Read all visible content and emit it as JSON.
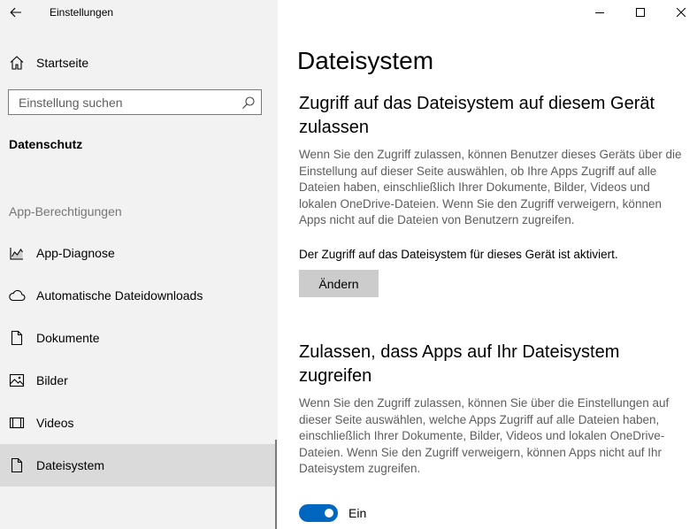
{
  "window": {
    "title": "Einstellungen",
    "controls": [
      "minimize",
      "maximize",
      "close"
    ]
  },
  "sidebar": {
    "home_label": "Startseite",
    "search_placeholder": "Einstellung suchen",
    "section_title": "Datenschutz",
    "group_title": "App-Berechtigungen",
    "items": [
      {
        "label": "App-Diagnose",
        "icon": "app-diagnose-icon"
      },
      {
        "label": "Automatische Dateidownloads",
        "icon": "cloud-icon"
      },
      {
        "label": "Dokumente",
        "icon": "document-icon"
      },
      {
        "label": "Bilder",
        "icon": "image-icon"
      },
      {
        "label": "Videos",
        "icon": "video-icon"
      },
      {
        "label": "Dateisystem",
        "icon": "document-icon",
        "selected": true
      }
    ]
  },
  "main": {
    "title": "Dateisystem",
    "device_section": {
      "heading": "Zugriff auf das Dateisystem auf diesem Gerät zulassen",
      "description": "Wenn Sie den Zugriff zulassen, können Benutzer dieses Geräts über die Einstellung auf dieser Seite auswählen, ob Ihre Apps Zugriff auf alle Dateien haben, einschließlich Ihrer Dokumente, Bilder, Videos und lokalen OneDrive-Dateien. Wenn Sie den Zugriff verweigern, können Apps nicht auf die Dateien von Benutzern zugreifen.",
      "status": "Der Zugriff auf das Dateisystem für dieses Gerät ist aktiviert.",
      "button_label": "Ändern"
    },
    "apps_section": {
      "heading": "Zulassen, dass Apps auf Ihr Dateisystem zugreifen",
      "description": "Wenn Sie den Zugriff zulassen, können Sie über die Einstellungen auf dieser Seite auswählen, welche Apps Zugriff auf alle Dateien haben, einschließlich Ihrer Dokumente, Bilder, Videos und lokalen OneDrive-Dateien. Wenn Sie den Zugriff verweigern, können Apps nicht auf Ihr Dateisystem zugreifen.",
      "toggle_state": "on",
      "toggle_label": "Ein"
    }
  },
  "colors": {
    "sidebar_bg": "#f2f2f2",
    "selected_bg": "#dadada",
    "accent": "#0067c0",
    "button_bg": "#cccccc"
  }
}
